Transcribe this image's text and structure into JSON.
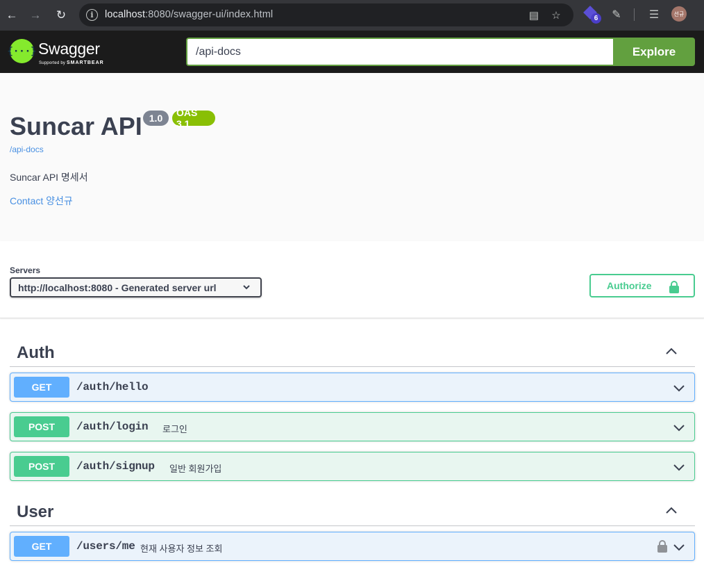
{
  "browser": {
    "url_host": "localhost",
    "url_path": ":8080/swagger-ui/index.html",
    "extension_badge": "6",
    "profile_initials": "선규"
  },
  "topbar": {
    "logo_text": "Swagger",
    "logo_glyph": "{···}",
    "logo_supported_by": "Supported by",
    "logo_smartbear": "SMARTBEAR",
    "spec_url": "/api-docs",
    "explore_label": "Explore"
  },
  "info": {
    "title": "Suncar API",
    "version": "1.0",
    "oas": "OAS 3.1",
    "spec_link": "/api-docs",
    "description": "Suncar API 명세서",
    "contact": "Contact 양선규"
  },
  "scheme": {
    "servers_label": "Servers",
    "selected_server": "http://localhost:8080 - Generated server url",
    "authorize_label": "Authorize"
  },
  "tags": [
    {
      "name": "Auth",
      "operations": [
        {
          "method": "GET",
          "path": "/auth/hello",
          "summary": ""
        },
        {
          "method": "POST",
          "path": "/auth/login",
          "summary": "로그인"
        },
        {
          "method": "POST",
          "path": "/auth/signup",
          "summary": "일반 회원가입"
        }
      ]
    },
    {
      "name": "User",
      "operations": [
        {
          "method": "GET",
          "path": "/users/me",
          "summary": "현재 사용자 정보 조회"
        }
      ]
    }
  ],
  "colors": {
    "get": "#61affe",
    "post": "#49cc90",
    "swagger_green": "#62a03f",
    "topbar_bg": "#1b1b1b"
  }
}
